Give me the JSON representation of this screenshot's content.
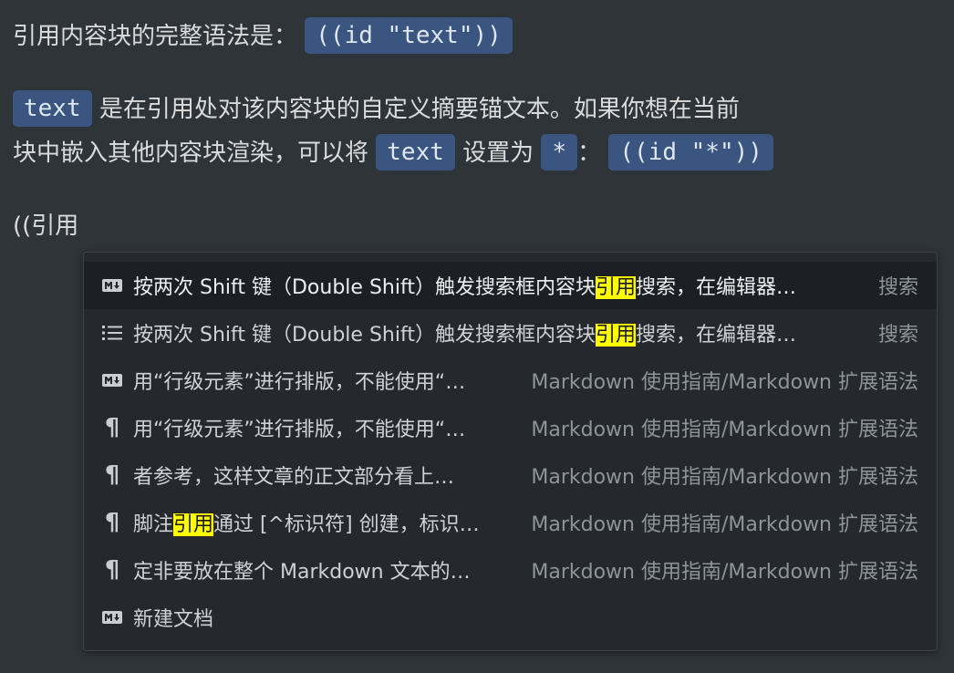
{
  "paragraph1": {
    "text": "引用内容块的完整语法是：",
    "code": "((id \"text\"))"
  },
  "paragraph2": {
    "code_text": "text",
    "line1": "是在引用处对该内容块的自定义摘要锚文本。如果你想在当前",
    "line2_a": "块中嵌入其他内容块渲染，可以将",
    "code_text2": "text",
    "line2_b": "设置为",
    "code_star": "*",
    "colon": "：",
    "code_full": "((id \"*\"))"
  },
  "input_line": "((引用",
  "search_results": [
    {
      "icon": "markdown-icon",
      "pre": "按两次 Shift 键（Double Shift）触发搜索框内容块",
      "hl": "引用",
      "post": "搜索，在编辑器…",
      "path": "搜索",
      "selected": true
    },
    {
      "icon": "list-icon",
      "pre": "按两次 Shift 键（Double Shift）触发搜索框内容块",
      "hl": "引用",
      "post": "搜索，在编辑器…",
      "path": "搜索",
      "selected": false
    },
    {
      "icon": "markdown-icon",
      "pre": "用“行级元素”进行排版，不能使用“…",
      "hl": "",
      "post": "",
      "path": "Markdown 使用指南/Markdown 扩展语法",
      "selected": false
    },
    {
      "icon": "paragraph-icon",
      "pre": "用“行级元素”进行排版，不能使用“…",
      "hl": "",
      "post": "",
      "path": "Markdown 使用指南/Markdown 扩展语法",
      "selected": false
    },
    {
      "icon": "paragraph-icon",
      "pre": "者参考，这样文章的正文部分看上…",
      "hl": "",
      "post": "",
      "path": "Markdown 使用指南/Markdown 扩展语法",
      "selected": false
    },
    {
      "icon": "paragraph-icon",
      "pre": "脚注",
      "hl": "引用",
      "post": "通过 [^标识符] 创建，标识…",
      "path": "Markdown 使用指南/Markdown 扩展语法",
      "selected": false
    },
    {
      "icon": "paragraph-icon",
      "pre": "定非要放在整个 Markdown 文本的…",
      "hl": "",
      "post": "",
      "path": "Markdown 使用指南/Markdown 扩展语法",
      "selected": false
    },
    {
      "icon": "markdown-icon",
      "pre": "新建文档",
      "hl": "",
      "post": "",
      "path": "",
      "selected": false
    }
  ]
}
